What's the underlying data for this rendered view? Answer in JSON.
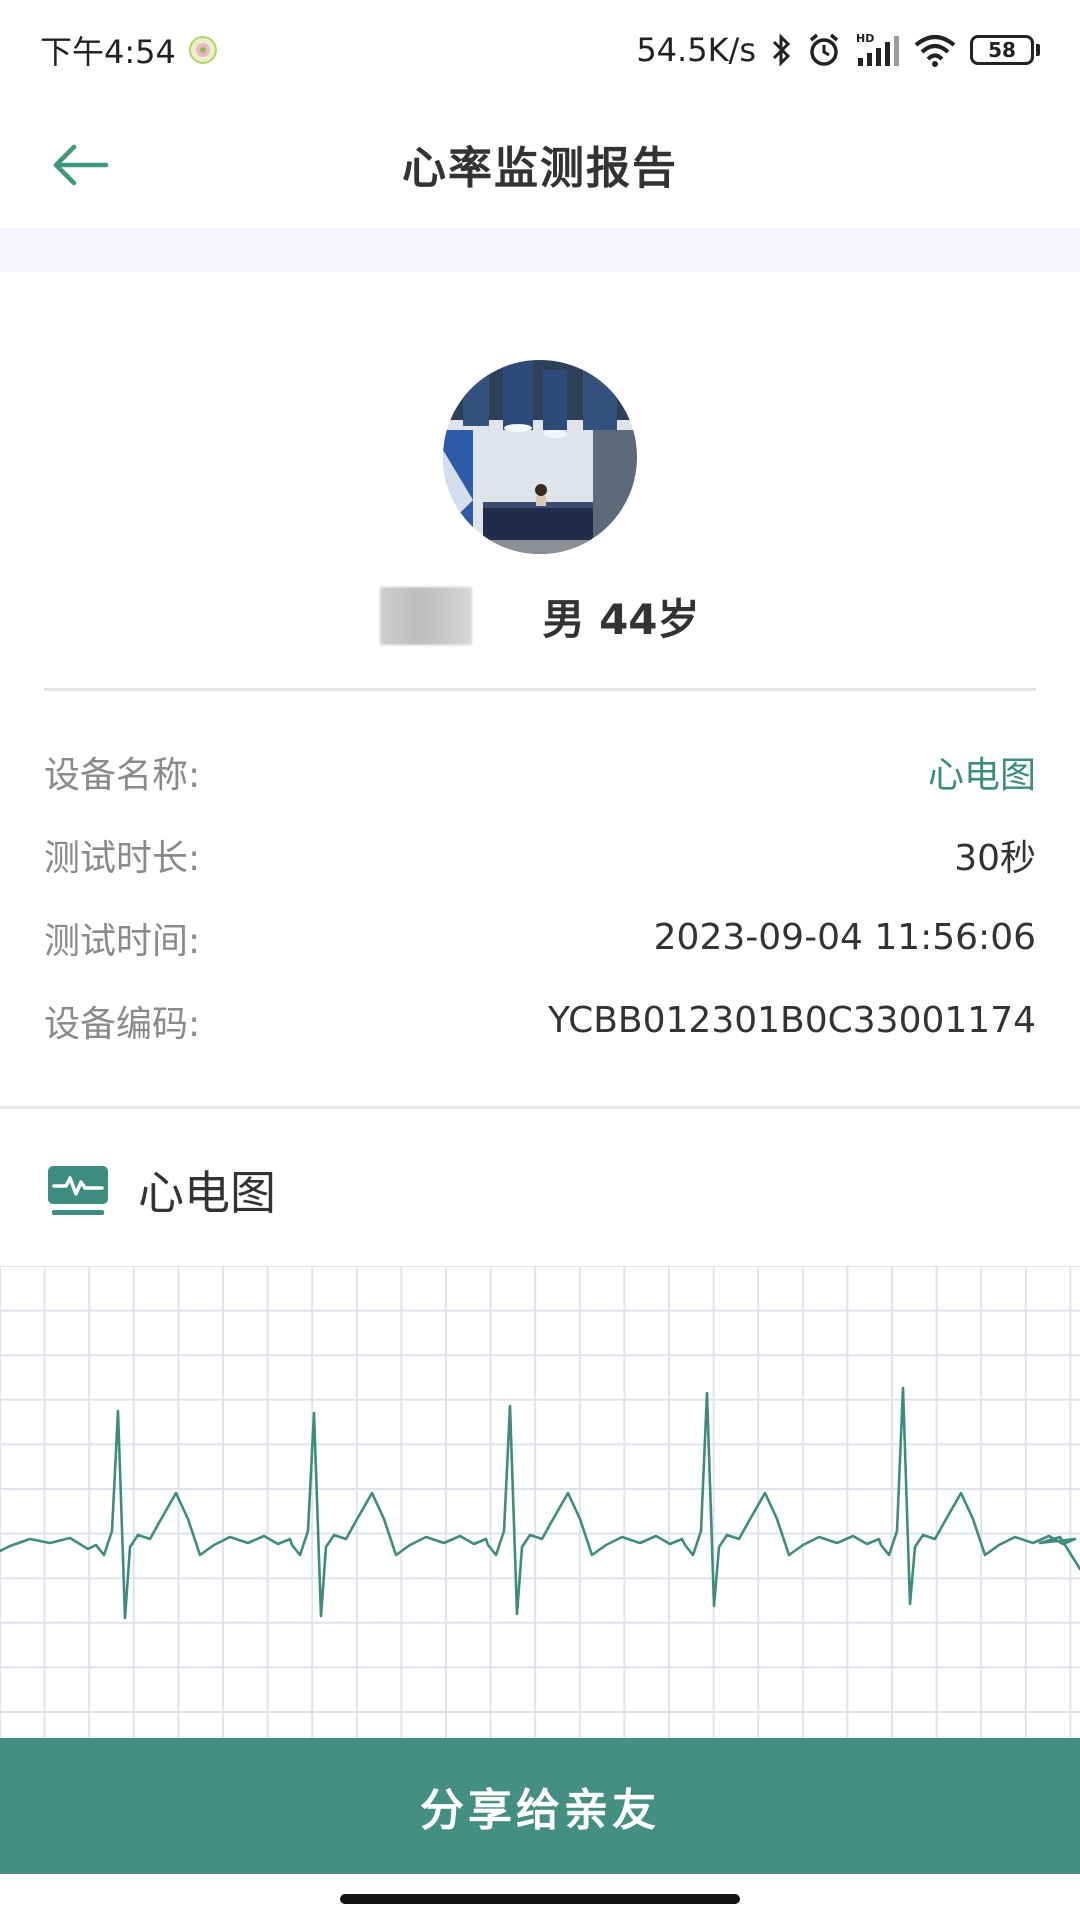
{
  "status_bar": {
    "time": "下午4:54",
    "net_speed": "54.5K/s",
    "battery": "58",
    "icons": [
      "app-notification-icon",
      "bluetooth-icon",
      "alarm-icon",
      "hd-signal-icon",
      "wifi-icon",
      "battery-icon"
    ]
  },
  "nav": {
    "title": "心率监测报告",
    "back_icon": "arrow-left-icon"
  },
  "profile": {
    "gender_age": "男 44岁"
  },
  "info": [
    {
      "label": "设备名称:",
      "value": "心电图",
      "accent": true
    },
    {
      "label": "测试时长:",
      "value": "30秒",
      "accent": false
    },
    {
      "label": "测试时间:",
      "value": "2023-09-04 11:56:06",
      "accent": false
    },
    {
      "label": "设备编码:",
      "value": "YCBB012301B0C33001174",
      "accent": false
    }
  ],
  "ecg": {
    "section_title": "心电图",
    "icon": "ecg-monitor-icon"
  },
  "actions": {
    "share_label": "分享给亲友"
  },
  "colors": {
    "accent": "#448e82",
    "accent_text": "#3d8c80",
    "grid": "#dfe3ec",
    "trace": "#3f8c7f"
  }
}
